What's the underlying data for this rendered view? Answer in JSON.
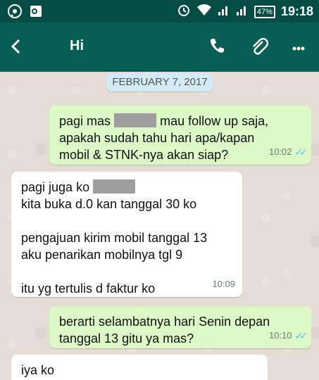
{
  "status_bar": {
    "time": "19:18",
    "battery": "47%"
  },
  "header": {
    "title": "Hi"
  },
  "chat": {
    "date": "FEBRUARY 7, 2017",
    "messages": [
      {
        "direction": "out",
        "lines": [
          "pagi mas",
          "mau follow up saja,",
          "apakah sudah tahu hari apa/kapan",
          "mobil & STNK-nya akan siap?"
        ],
        "time": "10:02"
      },
      {
        "direction": "in",
        "lines": [
          "pagi juga ko",
          "kita buka d.0 kan tanggal 30 ko",
          "",
          "pengajuan kirim mobil tanggal 13",
          "aku penarikan mobilnya tgl 9",
          "",
          "itu yg tertulis d faktur ko"
        ],
        "time": "10:09"
      },
      {
        "direction": "out",
        "lines": [
          "berarti selambatnya hari Senin depan",
          "tanggal 13 gitu ya mas?"
        ],
        "time": "10:10"
      },
      {
        "direction": "in",
        "lines": [
          "iya ko"
        ],
        "time": ""
      }
    ]
  },
  "colors": {
    "app_bar": "#075e54",
    "status_bar": "#054d44",
    "outgoing_bubble": "#dcf8c6",
    "incoming_bubble": "#ffffff"
  },
  "icons": [
    "whatsapp-icon",
    "outlook-icon",
    "alarm-icon",
    "wifi-icon",
    "signal-icon",
    "battery-icon",
    "back-arrow-icon",
    "phone-icon",
    "paperclip-icon",
    "more-icon",
    "double-check-icon"
  ]
}
